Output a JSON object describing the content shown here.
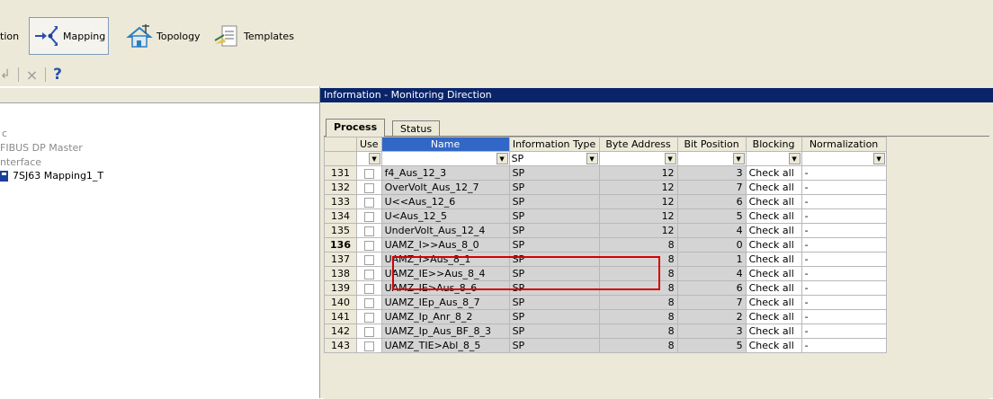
{
  "toolbar": {
    "items": [
      {
        "label": "tion",
        "icon": "truncated-icon"
      },
      {
        "label": "Mapping",
        "icon": "mapping-icon"
      },
      {
        "label": "Topology",
        "icon": "topology-icon"
      },
      {
        "label": "Templates",
        "icon": "templates-icon"
      }
    ],
    "row2": [
      "↲",
      "×",
      "?"
    ]
  },
  "left_panel": {
    "items": [
      "c",
      "FIBUS DP Master",
      "nterface",
      "7SJ63 Mapping1_T"
    ]
  },
  "panel_title": "Information - Monitoring Direction",
  "tabs": [
    "Process",
    "Status"
  ],
  "columns": [
    "Use",
    "Name",
    "Information Type",
    "Byte Address",
    "Bit Position",
    "Blocking",
    "Normalization"
  ],
  "filter": {
    "name": "",
    "info_type": "SP",
    "byte": "",
    "bit": "",
    "blocking": "",
    "normalization": ""
  },
  "rows": [
    {
      "n": "131",
      "name": "f4_Aus_12_3",
      "type": "SP",
      "byte": "12",
      "bit": "3",
      "blocking": "Check all",
      "norm": "-"
    },
    {
      "n": "132",
      "name": "OverVolt_Aus_12_7",
      "type": "SP",
      "byte": "12",
      "bit": "7",
      "blocking": "Check all",
      "norm": "-"
    },
    {
      "n": "133",
      "name": "U<<Aus_12_6",
      "type": "SP",
      "byte": "12",
      "bit": "6",
      "blocking": "Check all",
      "norm": "-"
    },
    {
      "n": "134",
      "name": "U<Aus_12_5",
      "type": "SP",
      "byte": "12",
      "bit": "5",
      "blocking": "Check all",
      "norm": "-"
    },
    {
      "n": "135",
      "name": "UnderVolt_Aus_12_4",
      "type": "SP",
      "byte": "12",
      "bit": "4",
      "blocking": "Check all",
      "norm": "-"
    },
    {
      "n": "136",
      "name": "UAMZ_I>>Aus_8_0",
      "type": "SP",
      "byte": "8",
      "bit": "0",
      "blocking": "Check all",
      "norm": "-"
    },
    {
      "n": "137",
      "name": "UAMZ_I>Aus_8_1",
      "type": "SP",
      "byte": "8",
      "bit": "1",
      "blocking": "Check all",
      "norm": "-"
    },
    {
      "n": "138",
      "name": "UAMZ_IE>>Aus_8_4",
      "type": "SP",
      "byte": "8",
      "bit": "4",
      "blocking": "Check all",
      "norm": "-"
    },
    {
      "n": "139",
      "name": "UAMZ_IE>Aus_8_6",
      "type": "SP",
      "byte": "8",
      "bit": "6",
      "blocking": "Check all",
      "norm": "-"
    },
    {
      "n": "140",
      "name": "UAMZ_IEp_Aus_8_7",
      "type": "SP",
      "byte": "8",
      "bit": "7",
      "blocking": "Check all",
      "norm": "-"
    },
    {
      "n": "141",
      "name": "UAMZ_Ip_Anr_8_2",
      "type": "SP",
      "byte": "8",
      "bit": "2",
      "blocking": "Check all",
      "norm": "-"
    },
    {
      "n": "142",
      "name": "UAMZ_Ip_Aus_BF_8_3",
      "type": "SP",
      "byte": "8",
      "bit": "3",
      "blocking": "Check all",
      "norm": "-"
    },
    {
      "n": "143",
      "name": "UAMZ_TIE>Abl_8_5",
      "type": "SP",
      "byte": "8",
      "bit": "5",
      "blocking": "Check all",
      "norm": "-"
    }
  ],
  "current_row": "136",
  "colors": {
    "title_bar": "#0a246a",
    "name_header": "#3167c6",
    "highlight": "#d40000"
  }
}
